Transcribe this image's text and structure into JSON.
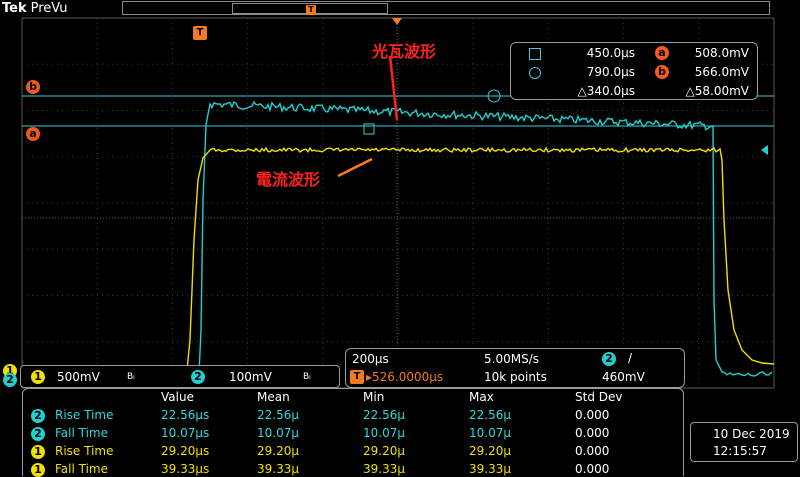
{
  "header": {
    "brand": "Tek",
    "mode": "PreVu",
    "record_marker": "T"
  },
  "annotations": {
    "light_wave": "光瓦波形",
    "current_wave": "電流波形"
  },
  "cursors": {
    "time_a": "450.0µs",
    "volt_a": "508.0mV",
    "time_b": "790.0µs",
    "volt_b": "566.0mV",
    "delta_t": "△340.0µs",
    "delta_v": "△58.00mV",
    "marker_a": "a",
    "marker_b": "b"
  },
  "trigger": {
    "label": "T"
  },
  "horizontal": {
    "scale": "200µs",
    "sample_rate": "5.00MS/s",
    "trigger_source": "2",
    "slope": "/",
    "position": "▸526.0000µs",
    "record_length": "10k points",
    "trigger_level": "460mV"
  },
  "channels": {
    "ch1": {
      "id": "1",
      "scale": "500mV",
      "bw": "Bₗ",
      "color": "#f0e000"
    },
    "ch2": {
      "id": "2",
      "scale": "100mV",
      "bw": "Bₗ",
      "color": "#20d0d0"
    }
  },
  "measurements": {
    "headers": [
      "Value",
      "Mean",
      "Min",
      "Max",
      "Std Dev"
    ],
    "rows": [
      {
        "ch": "2",
        "name": "Rise Time",
        "value": "22.56µs",
        "mean": "22.56µ",
        "min": "22.56µ",
        "max": "22.56µ",
        "std": "0.000"
      },
      {
        "ch": "2",
        "name": "Fall Time",
        "value": "10.07µs",
        "mean": "10.07µ",
        "min": "10.07µ",
        "max": "10.07µ",
        "std": "0.000"
      },
      {
        "ch": "1",
        "name": "Rise Time",
        "value": "29.20µs",
        "mean": "29.20µ",
        "min": "29.20µ",
        "max": "29.20µ",
        "std": "0.000"
      },
      {
        "ch": "1",
        "name": "Fall Time",
        "value": "39.33µs",
        "mean": "39.33µ",
        "min": "39.33µ",
        "max": "39.33µ",
        "std": "0.000"
      }
    ]
  },
  "datetime": {
    "date": "10 Dec  2019",
    "time": "12:15:57"
  },
  "colors": {
    "ch1": "#f0e000",
    "ch2": "#20d0d0",
    "marker": "#f05a1e",
    "annotation": "#ff2020"
  }
}
